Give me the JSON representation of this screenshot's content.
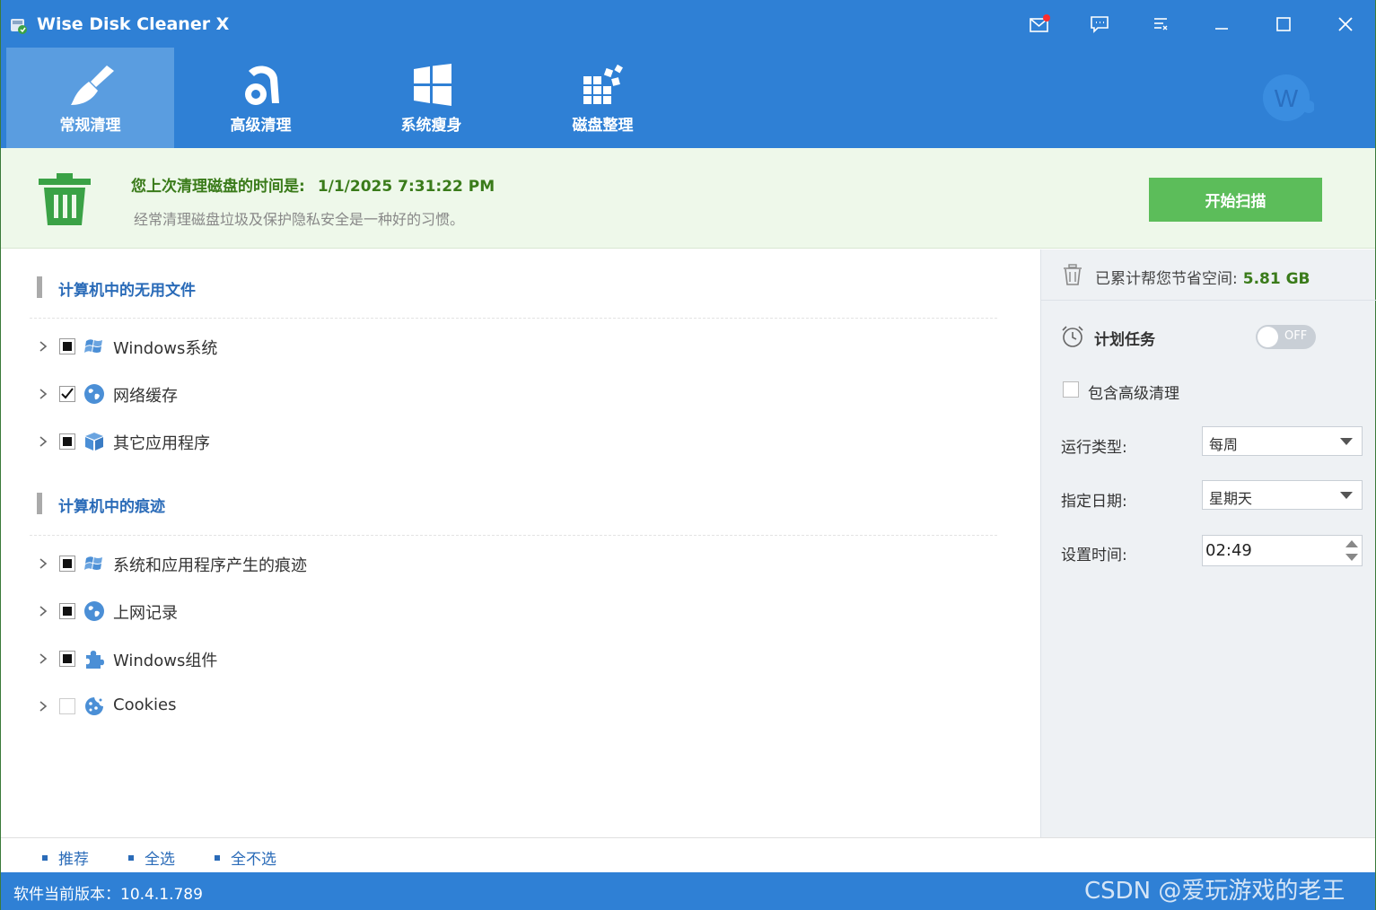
{
  "app": {
    "title": "Wise Disk Cleaner X"
  },
  "nav": {
    "tabs": [
      {
        "label": "常规清理",
        "icon": "broom-icon",
        "active": true
      },
      {
        "label": "高级清理",
        "icon": "vacuum-icon",
        "active": false
      },
      {
        "label": "系统瘦身",
        "icon": "windows-logo-icon",
        "active": false
      },
      {
        "label": "磁盘整理",
        "icon": "defrag-blocks-icon",
        "active": false
      }
    ],
    "avatar_letter": "W"
  },
  "banner": {
    "last_clean_label": "您上次清理磁盘的时间是:",
    "last_clean_time": "1/1/2025 7:31:22 PM",
    "tip": "经常清理磁盘垃圾及保护隐私安全是一种好的习惯。",
    "scan_button": "开始扫描"
  },
  "sections": [
    {
      "title": "计算机中的无用文件",
      "items": [
        {
          "label": "Windows系统",
          "check": "partial",
          "icon": "windows-icon"
        },
        {
          "label": "网络缓存",
          "check": "checked",
          "icon": "globe-icon"
        },
        {
          "label": "其它应用程序",
          "check": "partial",
          "icon": "box-icon"
        }
      ]
    },
    {
      "title": "计算机中的痕迹",
      "items": [
        {
          "label": "系统和应用程序产生的痕迹",
          "check": "partial",
          "icon": "windows-icon"
        },
        {
          "label": "上网记录",
          "check": "partial",
          "icon": "globe-icon"
        },
        {
          "label": "Windows组件",
          "check": "partial",
          "icon": "puzzle-icon"
        },
        {
          "label": "Cookies",
          "check": "unchecked",
          "icon": "cookie-icon"
        }
      ]
    }
  ],
  "bottom": {
    "recommend": "推荐",
    "select_all": "全选",
    "select_none": "全不选",
    "version": "软件当前版本：10.4.1.789",
    "watermark": "CSDN @爱玩游戏的老王"
  },
  "side": {
    "saved_label": "已累计帮您节省空间:",
    "saved_value": "5.81 GB",
    "schedule_title": "计划任务",
    "toggle_state": "OFF",
    "include_advanced": "包含高级清理",
    "run_type_label": "运行类型:",
    "run_type_value": "每周",
    "date_label": "指定日期:",
    "date_value": "星期天",
    "time_label": "设置时间:",
    "time_value": "02:49"
  },
  "colors": {
    "brand_blue": "#2f80d5",
    "active_tab": "#5a9de0",
    "accent_green": "#5cbd5a",
    "text_green": "#3a7b1a",
    "section_blue": "#2a6bb8"
  }
}
